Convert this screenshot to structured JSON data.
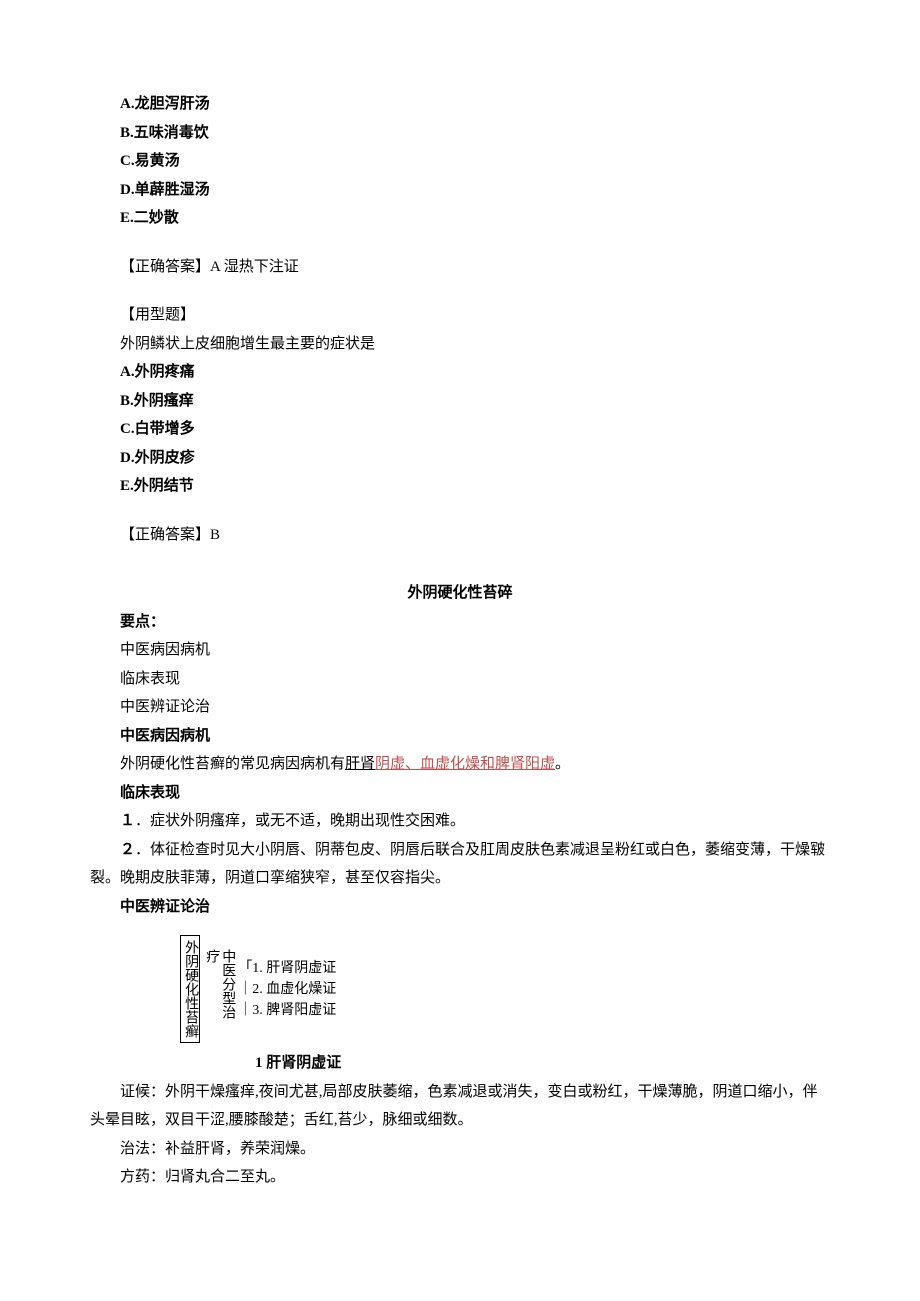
{
  "q1": {
    "A": "A.龙胆泻肝汤",
    "B": "B.五味消毒饮",
    "C": "C.易黄汤",
    "D": "D.单薜胜湿汤",
    "E": "E.二妙散",
    "ans": "【正确答案】A 湿热下注证"
  },
  "q2": {
    "tag": "【用型题】",
    "stem": "外阴鳞状上皮细胞增生最主要的症状是",
    "A": "A.外阴疼痛",
    "B": "B.外阴瘙痒",
    "C": "C.白带增多",
    "D": "D.外阴皮疹",
    "E": "E.外阴结节",
    "ans": "【正确答案】B"
  },
  "s": {
    "title": "外阴硬化性苔碎",
    "ydLabel": "要点：",
    "yd1": "中医病因病机",
    "yd2": "临床表现",
    "yd3": "中医辨证论治",
    "h1": "中医病因病机",
    "p1a": "外阴硬化性苔癣的常见病因病机有",
    "p1b": "肝肾",
    "p1c": "阴虚、血虚化燥和脾肾阳虚",
    "p1d": "。",
    "h2": "临床表现",
    "p2": "１．症状外阴瘙痒，或无不适，晚期出现性交困难。",
    "p3": "２．体征检查时见大小阴唇、阴蒂包皮、阴唇后联合及肛周皮肤色素减退呈粉红或白色，萎缩变薄，干燥皲裂。晚期皮肤菲薄，阴道口挛缩狭窄，甚至仅容指尖。",
    "h3": "中医辨证论治",
    "dg": {
      "b1": "外阴硬化性苔癣",
      "b2": "中医分型治疗",
      "l1": "1. 肝肾阴虚证",
      "l2": "2. 血虚化燥证",
      "l3": "3. 脾肾阳虚证"
    },
    "sub1": "1 肝肾阴虚证",
    "z1": "证候：外阴干燥瘙痒,夜间尤甚,局部皮肤萎缩，色素减退或消失，变白或粉红，干燥薄脆，阴道口缩小，伴头晕目眩，双目干涩,腰膝酸楚；舌红,苔少，脉细或细数。",
    "z2": "治法：补益肝肾，养荣润燥。",
    "z3": "方药：归肾丸合二至丸。"
  }
}
